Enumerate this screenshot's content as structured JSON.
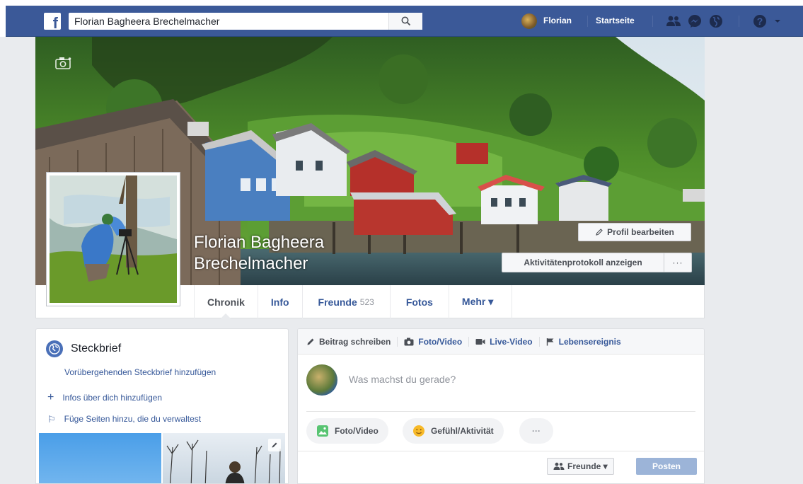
{
  "topbar": {
    "search_value": "Florian Bagheera Brechelmacher",
    "user_name": "Florian",
    "home_label": "Startseite"
  },
  "cover": {
    "name_line1": "Florian Bagheera",
    "name_line2": "Brechelmacher",
    "edit_profile_label": "Profil bearbeiten",
    "activity_log_label": "Aktivitätenprotokoll anzeigen",
    "more_label": "···"
  },
  "tabs": [
    {
      "label": "Chronik",
      "count": ""
    },
    {
      "label": "Info",
      "count": ""
    },
    {
      "label": "Freunde",
      "count": "523"
    },
    {
      "label": "Fotos",
      "count": ""
    },
    {
      "label": "Mehr ▾",
      "count": ""
    }
  ],
  "intro": {
    "title": "Steckbrief",
    "add_temp_bio": "Vorübergehenden Steckbrief hinzufügen",
    "add_info": "Infos über dich hinzufügen",
    "add_pages": "Füge Seiten hinzu, die du verwaltest",
    "add_info_icon": "+",
    "add_pages_icon": "⚐"
  },
  "composer": {
    "tab_write": "Beitrag schreiben",
    "tab_photo": "Foto/Video",
    "tab_live": "Live-Video",
    "tab_event": "Lebensereignis",
    "placeholder": "Was machst du gerade?",
    "pill_photo": "Foto/Video",
    "pill_feeling": "Gefühl/Aktivität",
    "pill_more": "···",
    "audience": "Freunde ▾",
    "post": "Posten"
  },
  "colors": {
    "brand_blue": "#3b5998",
    "link_blue": "#365899",
    "page_bg": "#e9ebee"
  }
}
